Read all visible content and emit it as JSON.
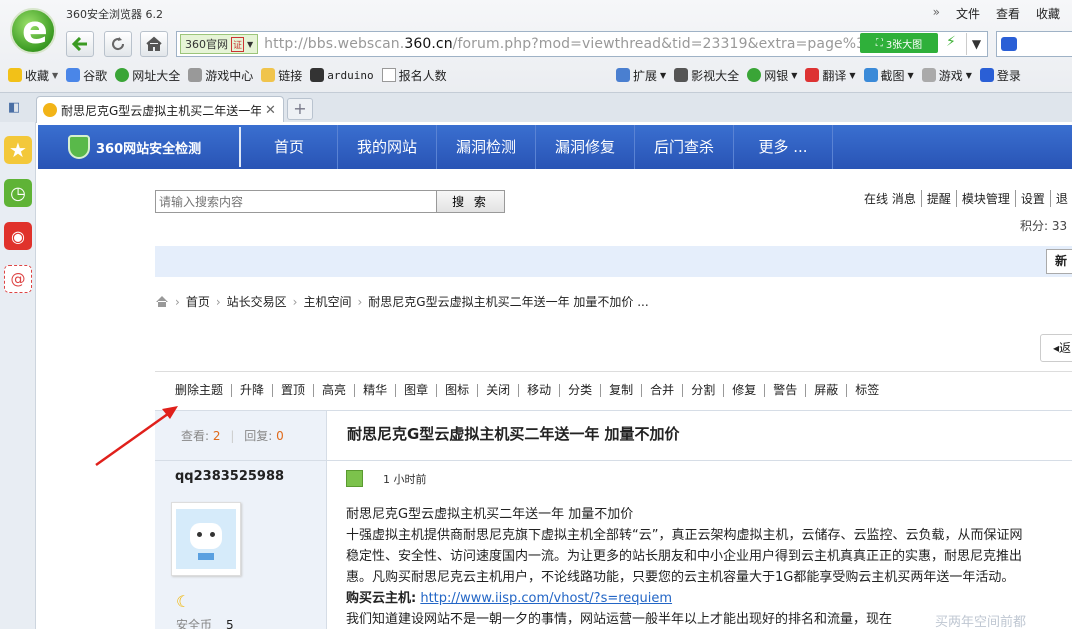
{
  "browser": {
    "app_title": "360安全浏览器 6.2",
    "top_menu": [
      "»",
      "文件",
      "查看",
      "收藏"
    ],
    "site_badge": "360官网",
    "cert_badge": "证",
    "url_prefix": "http://bbs.webscan.",
    "url_domain": "360.cn",
    "url_suffix": "/forum.php?mod=viewthread&tid=23319&extra=page%3D1",
    "screenshot_btn": "3张大图",
    "favorites": [
      "收藏",
      "谷歌",
      "网址大全",
      "游戏中心",
      "链接",
      "arduino",
      "报名人数"
    ],
    "toolbar_right": [
      "扩展",
      "影视大全",
      "网银",
      "翻译",
      "截图",
      "游戏",
      "登录"
    ],
    "tab_title": "耐思尼克G型云虚拟主机买二年送一年",
    "new_tab": "+"
  },
  "site": {
    "brand": "360网站安全检测",
    "nav": [
      "首页",
      "我的网站",
      "漏洞检测",
      "漏洞修复",
      "后门查杀",
      "更多 ..."
    ],
    "search_placeholder": "请输入搜索内容",
    "search_btn": "搜 索",
    "user_menu": [
      "在线 消息",
      "提醒",
      "模块管理",
      "设置",
      "退"
    ],
    "points_label": "积分: 33",
    "bluebar_btn": "新",
    "breadcrumb": [
      "首页",
      "站长交易区",
      "主机空间",
      "耐思尼克G型云虚拟主机买二年送一年 加量不加价 ..."
    ],
    "back_btn": "返",
    "mod_actions": [
      "删除主题",
      "升降",
      "置顶",
      "高亮",
      "精华",
      "图章",
      "图标",
      "关闭",
      "移动",
      "分类",
      "复制",
      "合并",
      "分割",
      "修复",
      "警告",
      "屏蔽",
      "标签"
    ]
  },
  "thread": {
    "views_label": "查看:",
    "views": "2",
    "replies_label": "回复:",
    "replies": "0",
    "title": "耐思尼克G型云虚拟主机买二年送一年 加量不加价",
    "author": "qq2383525988",
    "time": "1 小时前",
    "coins_label": "安全币",
    "coins": "5",
    "body_lines": [
      "耐思尼克G型云虚拟主机买二年送一年 加量不加价",
      "十强虚拟主机提供商耐思尼克旗下虚拟主机全部转“云”，真正云架构虚拟主机，云储存、云监控、云负载，从而保证网",
      "稳定性、安全性、访问速度国内一流。为让更多的站长朋友和中小企业用户得到云主机真真正正的实惠，耐思尼克推出",
      "惠。凡购买耐思尼克云主机用户，不论线路功能，只要您的云主机容量大于1G都能享受购云主机买两年送一年活动。"
    ],
    "buy_label": "购买云主机:",
    "buy_link": "http://www.iisp.com/vhost/?s=requiem",
    "body_last": "我们知道建设网站不是一朝一夕的事情，网站运营一般半年以上才能出现好的排名和流量，现在"
  },
  "watermark": "买两年空间前都"
}
